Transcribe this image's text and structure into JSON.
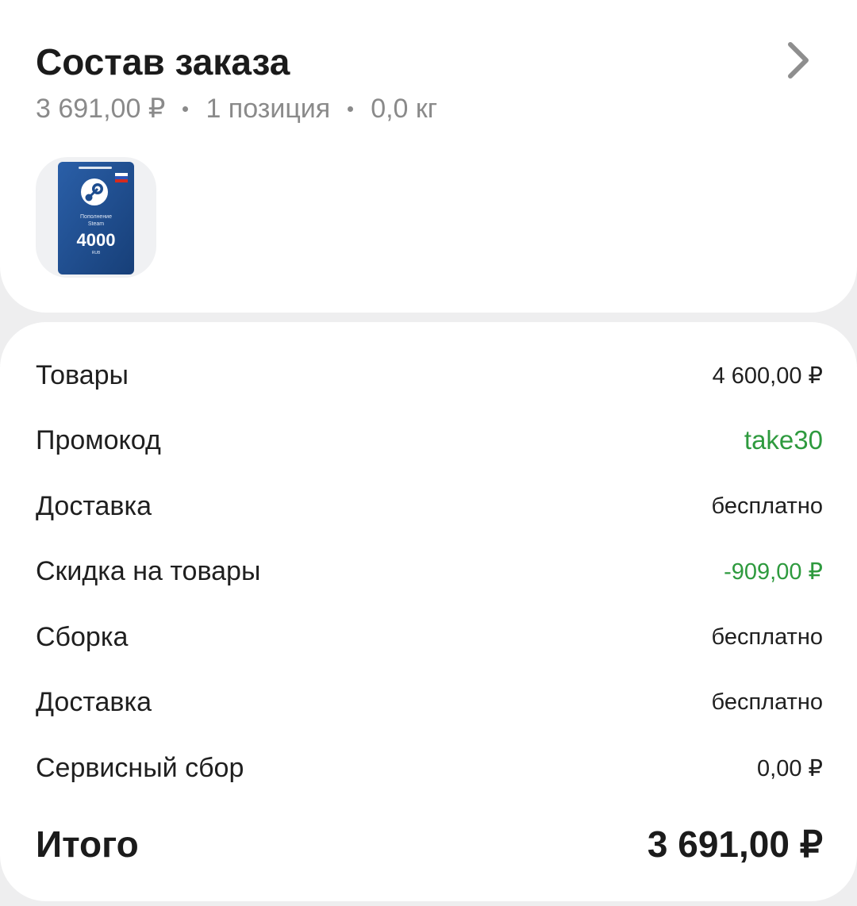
{
  "order": {
    "title": "Состав заказа",
    "price": "3 691,00 ₽",
    "positions": "1 позиция",
    "weight": "0,0 кг"
  },
  "product_card": {
    "caption_line1": "Пополнение",
    "caption_line2": "Steam",
    "amount": "4000",
    "currency": "RUB"
  },
  "summary": {
    "rows": [
      {
        "label": "Товары",
        "value": "4 600,00 ₽"
      },
      {
        "label": "Промокод",
        "value": "take30"
      },
      {
        "label": "Доставка",
        "value": "бесплатно"
      },
      {
        "label": "Скидка на товары",
        "value": "-909,00 ₽"
      },
      {
        "label": "Сборка",
        "value": "бесплатно"
      },
      {
        "label": "Доставка",
        "value": "бесплатно"
      },
      {
        "label": "Сервисный сбор",
        "value": "0,00 ₽"
      }
    ],
    "total_label": "Итого",
    "total_value": "3 691,00 ₽"
  },
  "icons": {
    "chevron": "chevron-right-icon",
    "steam_logo": "steam-logo-icon",
    "flag": "russia-flag-icon"
  },
  "colors": {
    "accent_green": "#2e9a3e",
    "card_blue": "#1d4d8f",
    "text_primary": "#1f1f1f",
    "text_secondary": "#8a8a8a"
  }
}
